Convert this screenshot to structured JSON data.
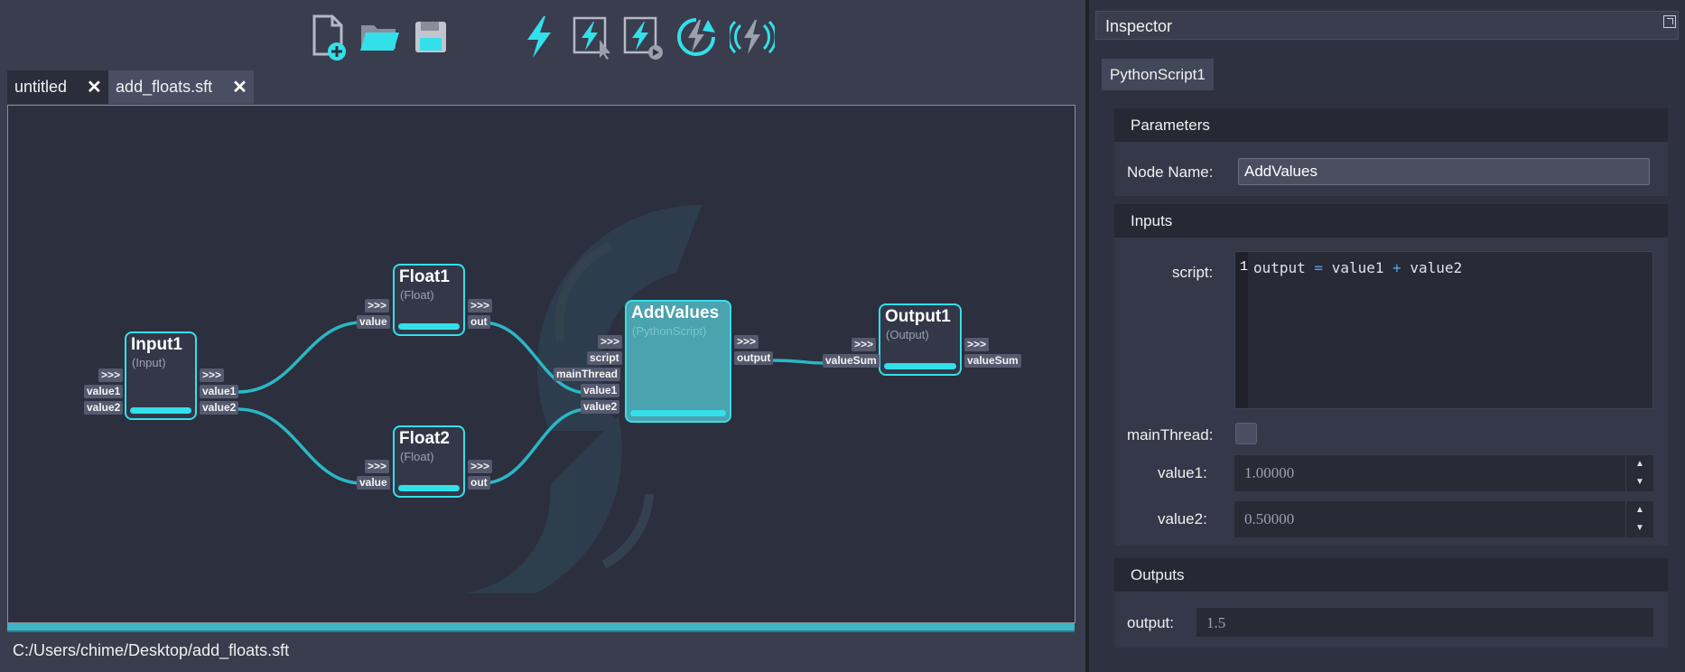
{
  "toolbar": {
    "buttons": [
      {
        "name": "new-file-icon"
      },
      {
        "name": "open-folder-icon"
      },
      {
        "name": "save-icon"
      },
      {
        "name": "run-icon"
      },
      {
        "name": "run-selected-icon"
      },
      {
        "name": "run-step-icon"
      },
      {
        "name": "run-loop-icon"
      },
      {
        "name": "run-broadcast-icon"
      }
    ]
  },
  "tabs": [
    {
      "label": "untitled",
      "close": "✕",
      "active": true
    },
    {
      "label": "add_floats.sft",
      "close": "✕",
      "active": false
    }
  ],
  "graph": {
    "nodes": {
      "input1": {
        "title": "Input1",
        "type": "(Input)",
        "in_ports": {
          "arrow": ">>>",
          "p1": "value1",
          "p2": "value2"
        },
        "out_ports": {
          "arrow": ">>>",
          "p1": "value1",
          "p2": "value2"
        }
      },
      "float1": {
        "title": "Float1",
        "type": "(Float)",
        "in_ports": {
          "arrow": ">>>",
          "p1": "value"
        },
        "out_ports": {
          "arrow": ">>>",
          "p1": "out"
        }
      },
      "float2": {
        "title": "Float2",
        "type": "(Float)",
        "in_ports": {
          "arrow": ">>>",
          "p1": "value"
        },
        "out_ports": {
          "arrow": ">>>",
          "p1": "out"
        }
      },
      "addvalues": {
        "title": "AddValues",
        "type": "(PythonScript)",
        "in_ports": {
          "arrow": ">>>",
          "p1": "script",
          "p2": "mainThread",
          "p3": "value1",
          "p4": "value2"
        },
        "out_ports": {
          "arrow": ">>>",
          "p1": "output"
        }
      },
      "output1": {
        "title": "Output1",
        "type": "(Output)",
        "in_ports": {
          "arrow": ">>>",
          "p1": "valueSum"
        },
        "out_ports": {
          "arrow": ">>>",
          "p1": "valueSum"
        }
      }
    },
    "accent_color": "#33e0ea",
    "selected_node_color": "#4aa3ae"
  },
  "status": {
    "path": "C:/Users/chime/Desktop/add_floats.sft"
  },
  "inspector": {
    "title": "Inspector",
    "node_tab": "PythonScript1",
    "parameters": {
      "heading": "Parameters",
      "node_name_label": "Node Name:",
      "node_name_value": "AddValues"
    },
    "inputs": {
      "heading": "Inputs",
      "script_label": "script:",
      "script_line_number": "1",
      "script_code": {
        "t1": "output",
        "op1": " = ",
        "t2": "value1",
        "op2": " + ",
        "t3": "value2"
      },
      "main_thread_label": "mainThread:",
      "value1_label": "value1:",
      "value1": "1.00000",
      "value2_label": "value2:",
      "value2": "0.50000",
      "spin_up": "▲",
      "spin_down": "▼"
    },
    "outputs": {
      "heading": "Outputs",
      "output_label": "output:",
      "output_value": "1.5"
    }
  }
}
